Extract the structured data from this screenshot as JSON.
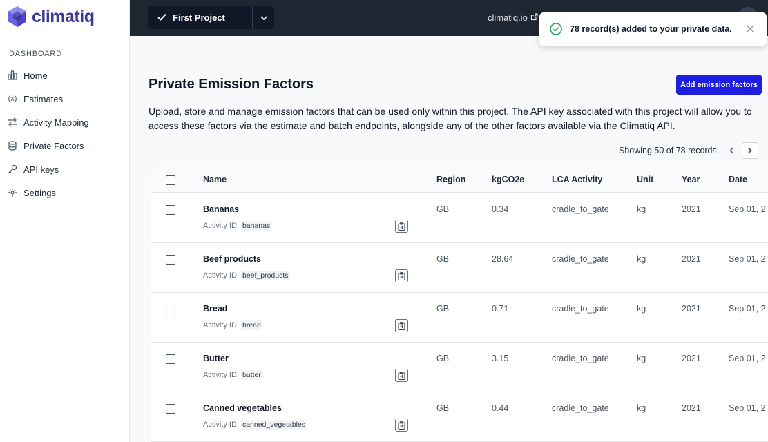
{
  "brand": {
    "name": "climatiq",
    "accent": "#5b5bd6"
  },
  "sidebar": {
    "section_label": "DASHBOARD",
    "items": [
      {
        "label": "Home",
        "icon": "bar-chart-icon"
      },
      {
        "label": "Estimates",
        "icon": "variable-icon"
      },
      {
        "label": "Activity Mapping",
        "icon": "arrows-exchange-icon"
      },
      {
        "label": "Private Factors",
        "icon": "database-icon"
      },
      {
        "label": "API keys",
        "icon": "key-icon"
      },
      {
        "label": "Settings",
        "icon": "gear-icon"
      }
    ]
  },
  "topbar": {
    "project": "First Project",
    "link": "climatiq.io"
  },
  "toast": {
    "message": "78 record(s) added to your private data."
  },
  "main": {
    "title": "Private Emission Factors",
    "add_button": "Add emission factors",
    "description": "Upload, store and manage emission factors that can be used only within this project. The API key associated with this project will allow you to access these factors via the estimate and batch endpoints, alongside any of the other factors available via the Climatiq API.",
    "pager_text": "Showing 50 of 78 records"
  },
  "table": {
    "headers": {
      "name": "Name",
      "region": "Region",
      "co2": "kgCO2e",
      "lca": "LCA Activity",
      "unit": "Unit",
      "year": "Year",
      "date": "Date"
    },
    "activity_label": "Activity ID:",
    "rows": [
      {
        "name": "Bananas",
        "activity_id": "bananas",
        "region": "GB",
        "co2": "0.34",
        "lca": "cradle_to_gate",
        "unit": "kg",
        "year": "2021",
        "date": "Sep 01, 2"
      },
      {
        "name": "Beef products",
        "activity_id": "beef_products",
        "region": "GB",
        "co2": "28.64",
        "lca": "cradle_to_gate",
        "unit": "kg",
        "year": "2021",
        "date": "Sep 01, 2"
      },
      {
        "name": "Bread",
        "activity_id": "bread",
        "region": "GB",
        "co2": "0.71",
        "lca": "cradle_to_gate",
        "unit": "kg",
        "year": "2021",
        "date": "Sep 01, 2"
      },
      {
        "name": "Butter",
        "activity_id": "butter",
        "region": "GB",
        "co2": "3.15",
        "lca": "cradle_to_gate",
        "unit": "kg",
        "year": "2021",
        "date": "Sep 01, 2"
      },
      {
        "name": "Canned vegetables",
        "activity_id": "canned_vegetables",
        "region": "GB",
        "co2": "0.44",
        "lca": "cradle_to_gate",
        "unit": "kg",
        "year": "2021",
        "date": "Sep 01, 2"
      }
    ]
  }
}
